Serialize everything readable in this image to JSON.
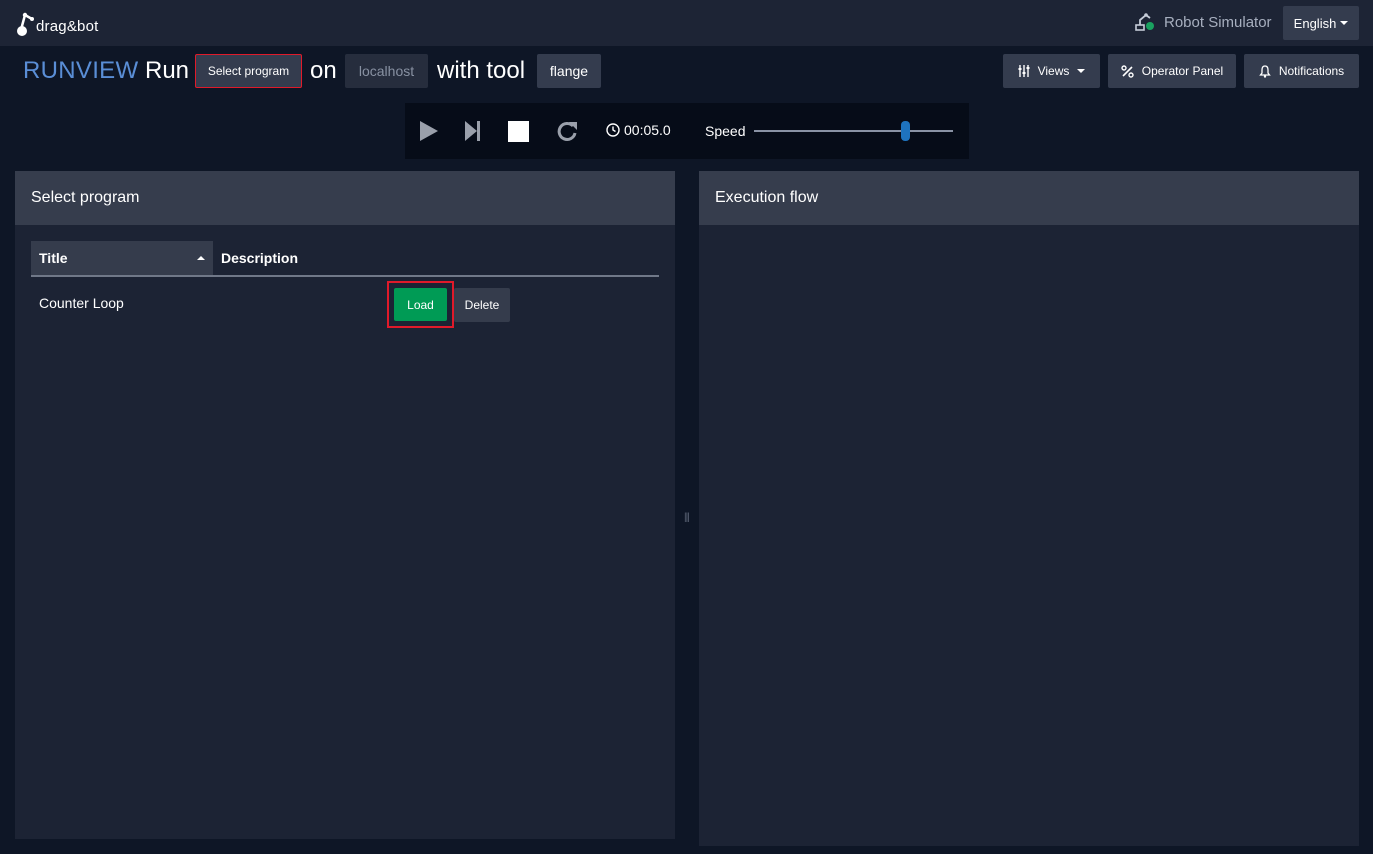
{
  "topbar": {
    "logo_text": "drag&bot",
    "robot_label": "Robot Simulator",
    "robot_status_color": "#1aa260",
    "language": "English"
  },
  "header": {
    "runview": "RUNVIEW",
    "run": "Run",
    "select_program": "Select program",
    "on": "on",
    "host": "localhost",
    "with_tool": "with tool",
    "tool": "flange",
    "views": "Views",
    "operator_panel": "Operator Panel",
    "notifications": "Notifications"
  },
  "controls": {
    "timer": "00:05.0",
    "speed_label": "Speed",
    "speed_fraction": 0.76
  },
  "select_panel": {
    "title": "Select program",
    "columns": [
      "Title",
      "Description"
    ],
    "rows": [
      {
        "title": "Counter Loop",
        "description": "",
        "load_label": "Load",
        "delete_label": "Delete"
      }
    ]
  },
  "execution_panel": {
    "title": "Execution flow"
  },
  "colors": {
    "accent_blue": "#5a8ed6",
    "load_green": "#009b55",
    "highlight_red": "#e01a2a"
  }
}
